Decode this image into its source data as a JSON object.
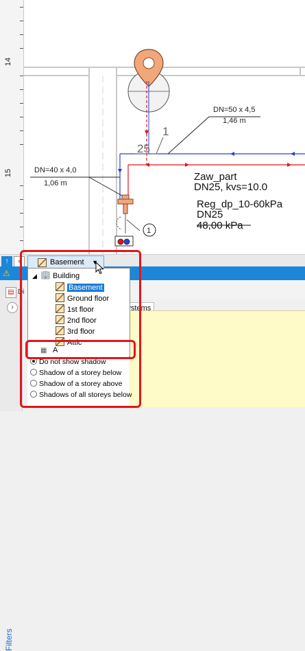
{
  "ruler": {
    "labels": [
      "14",
      "15"
    ]
  },
  "drawing": {
    "pipe1_dim": "DN=50 x 4,5",
    "pipe1_len": "1,46 m",
    "pipe2_dim": "DN=40 x 4,0",
    "pipe2_len": "1,06 m",
    "mark_25": "25",
    "mark_1": "1",
    "node_1": "1",
    "label_zaw": "Zaw_part",
    "label_dn25_kvs": "DN25, kvs=10.0",
    "label_reg": "Reg_dp_10-60kPa",
    "label_dn25": "DN25",
    "label_kpa": "48,00 kPa"
  },
  "storey_combo": {
    "selected": "Basement"
  },
  "tree": {
    "root": "Building",
    "items": [
      "Basement",
      "Ground floor",
      "1st floor",
      "2nd floor",
      "3rd floor",
      "Attic"
    ],
    "second_root": "A"
  },
  "tabs": {
    "heating": "ating systems"
  },
  "sidebar": {
    "filters": "Filters",
    "dia": "Di"
  },
  "shadow_options": [
    "Do not show shadow",
    "Shadow of a storey below",
    "Shadow of a storey above",
    "Shadows of all storeys below"
  ],
  "colors": {
    "accent": "#1c86d8",
    "highlight": "#e3151b",
    "pipe_red": "#e3151b",
    "pipe_blue": "#2b3fd9",
    "pin": "#f2a77a"
  }
}
